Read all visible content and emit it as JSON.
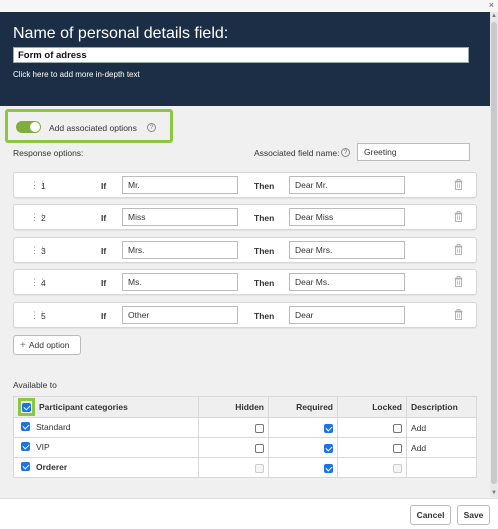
{
  "window": {
    "close_glyph": "×"
  },
  "header": {
    "title": "Name of personal details field:",
    "field_value": "Form of adress",
    "hint": "Click here to add more in-depth text"
  },
  "associated": {
    "toggle_label": "Add associated options",
    "toggle_on": true,
    "response_label": "Response options:",
    "field_name_label": "Associated field name:",
    "field_name_value": "Greeting"
  },
  "options": [
    {
      "num": "1",
      "if_label": "If",
      "if_value": "Mr.",
      "then_label": "Then",
      "then_value": "Dear Mr."
    },
    {
      "num": "2",
      "if_label": "If",
      "if_value": "Miss",
      "then_label": "Then",
      "then_value": "Dear Miss"
    },
    {
      "num": "3",
      "if_label": "If",
      "if_value": "Mrs.",
      "then_label": "Then",
      "then_value": "Dear Mrs."
    },
    {
      "num": "4",
      "if_label": "If",
      "if_value": "Ms.",
      "then_label": "Then",
      "then_value": "Dear Ms."
    },
    {
      "num": "5",
      "if_label": "If",
      "if_value": "Other",
      "then_label": "Then",
      "then_value": "Dear"
    }
  ],
  "add_option_label": "Add option",
  "available": {
    "label": "Available to",
    "columns": [
      "Participant categories",
      "Hidden",
      "Required",
      "Locked",
      "Description"
    ],
    "rows": [
      {
        "name": "Standard",
        "selected": true,
        "hidden": false,
        "required": true,
        "locked": false,
        "description": "Add"
      },
      {
        "name": "VIP",
        "selected": true,
        "hidden": false,
        "required": true,
        "locked": false,
        "description": "Add"
      },
      {
        "name": "Orderer",
        "selected": true,
        "hidden": false,
        "required": true,
        "locked": false,
        "description": ""
      }
    ]
  },
  "footer": {
    "cancel": "Cancel",
    "save": "Save"
  },
  "colors": {
    "header_bg": "#1c2e45",
    "highlight": "#8dc63f",
    "toggle_on": "#7fae3c",
    "checkbox": "#1a73e8"
  },
  "icons": [
    "help-icon",
    "drag-handle-icon",
    "trash-icon",
    "plus-icon",
    "close-icon"
  ]
}
